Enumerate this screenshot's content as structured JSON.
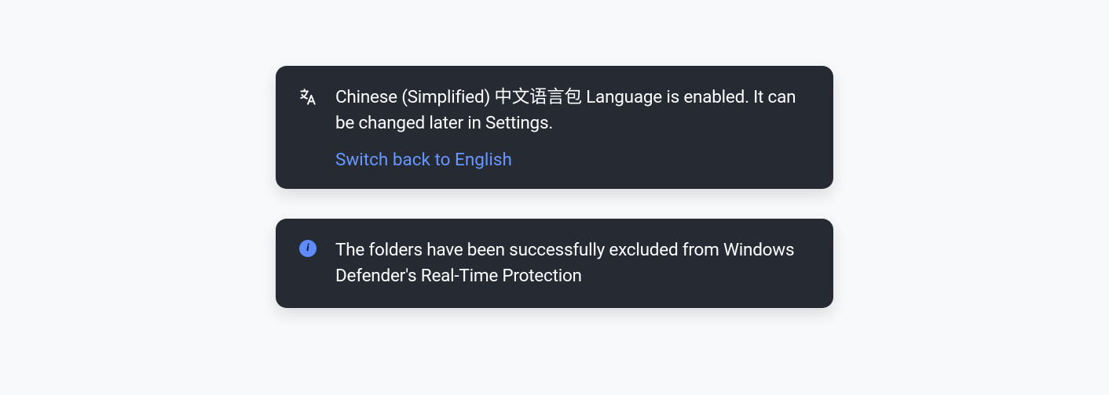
{
  "notifications": [
    {
      "icon": "translate-icon",
      "message": "Chinese (Simplified) 中文语言包 Language is enabled. It can be changed later in Settings.",
      "action": "Switch back to English"
    },
    {
      "icon": "info-icon",
      "message": "The folders have been successfully excluded from Windows Defender's Real-Time Protection"
    }
  ]
}
